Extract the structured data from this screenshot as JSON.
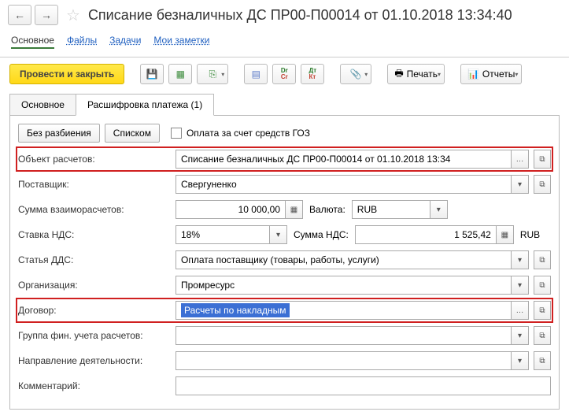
{
  "title": "Списание безналичных ДС ПР00-П00014 от 01.10.2018 13:34:40",
  "mainTabs": {
    "t0": "Основное",
    "t1": "Файлы",
    "t2": "Задачи",
    "t3": "Мои заметки"
  },
  "toolbar": {
    "post": "Провести и закрыть",
    "print": "Печать",
    "reports": "Отчеты"
  },
  "subTabs": {
    "t0": "Основное",
    "t1": "Расшифровка платежа (1)"
  },
  "buttons": {
    "noSplit": "Без разбиения",
    "list": "Списком"
  },
  "checkbox": {
    "goz": "Оплата за счет средств ГОЗ"
  },
  "labels": {
    "object": "Объект расчетов:",
    "supplier": "Поставщик:",
    "sum": "Сумма взаиморасчетов:",
    "currency": "Валюта:",
    "vatRate": "Ставка НДС:",
    "vatSum": "Сумма НДС:",
    "dds": "Статья ДДС:",
    "org": "Организация:",
    "contract": "Договор:",
    "group": "Группа фин. учета расчетов:",
    "direction": "Направление деятельности:",
    "comment": "Комментарий:"
  },
  "values": {
    "object": "Списание безналичных ДС ПР00-П00014 от 01.10.2018 13:34",
    "supplier": "Свергуненко",
    "sum": "10 000,00",
    "currency": "RUB",
    "vatRate": "18%",
    "vatSum": "1 525,42",
    "vatCur": "RUB",
    "dds": "Оплата поставщику (товары, работы, услуги)",
    "org": "Промресурс",
    "contract": "Расчеты по накладным",
    "group": "",
    "direction": "",
    "comment": ""
  }
}
